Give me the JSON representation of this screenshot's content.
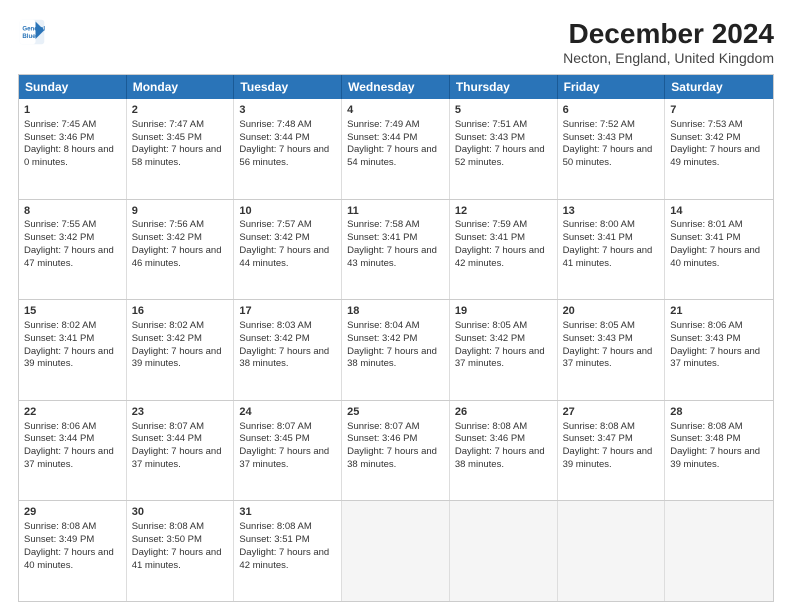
{
  "logo": {
    "line1": "General",
    "line2": "Blue"
  },
  "title": "December 2024",
  "subtitle": "Necton, England, United Kingdom",
  "headers": [
    "Sunday",
    "Monday",
    "Tuesday",
    "Wednesday",
    "Thursday",
    "Friday",
    "Saturday"
  ],
  "weeks": [
    [
      {
        "day": "1",
        "sunrise": "Sunrise: 7:45 AM",
        "sunset": "Sunset: 3:46 PM",
        "daylight": "Daylight: 8 hours and 0 minutes."
      },
      {
        "day": "2",
        "sunrise": "Sunrise: 7:47 AM",
        "sunset": "Sunset: 3:45 PM",
        "daylight": "Daylight: 7 hours and 58 minutes."
      },
      {
        "day": "3",
        "sunrise": "Sunrise: 7:48 AM",
        "sunset": "Sunset: 3:44 PM",
        "daylight": "Daylight: 7 hours and 56 minutes."
      },
      {
        "day": "4",
        "sunrise": "Sunrise: 7:49 AM",
        "sunset": "Sunset: 3:44 PM",
        "daylight": "Daylight: 7 hours and 54 minutes."
      },
      {
        "day": "5",
        "sunrise": "Sunrise: 7:51 AM",
        "sunset": "Sunset: 3:43 PM",
        "daylight": "Daylight: 7 hours and 52 minutes."
      },
      {
        "day": "6",
        "sunrise": "Sunrise: 7:52 AM",
        "sunset": "Sunset: 3:43 PM",
        "daylight": "Daylight: 7 hours and 50 minutes."
      },
      {
        "day": "7",
        "sunrise": "Sunrise: 7:53 AM",
        "sunset": "Sunset: 3:42 PM",
        "daylight": "Daylight: 7 hours and 49 minutes."
      }
    ],
    [
      {
        "day": "8",
        "sunrise": "Sunrise: 7:55 AM",
        "sunset": "Sunset: 3:42 PM",
        "daylight": "Daylight: 7 hours and 47 minutes."
      },
      {
        "day": "9",
        "sunrise": "Sunrise: 7:56 AM",
        "sunset": "Sunset: 3:42 PM",
        "daylight": "Daylight: 7 hours and 46 minutes."
      },
      {
        "day": "10",
        "sunrise": "Sunrise: 7:57 AM",
        "sunset": "Sunset: 3:42 PM",
        "daylight": "Daylight: 7 hours and 44 minutes."
      },
      {
        "day": "11",
        "sunrise": "Sunrise: 7:58 AM",
        "sunset": "Sunset: 3:41 PM",
        "daylight": "Daylight: 7 hours and 43 minutes."
      },
      {
        "day": "12",
        "sunrise": "Sunrise: 7:59 AM",
        "sunset": "Sunset: 3:41 PM",
        "daylight": "Daylight: 7 hours and 42 minutes."
      },
      {
        "day": "13",
        "sunrise": "Sunrise: 8:00 AM",
        "sunset": "Sunset: 3:41 PM",
        "daylight": "Daylight: 7 hours and 41 minutes."
      },
      {
        "day": "14",
        "sunrise": "Sunrise: 8:01 AM",
        "sunset": "Sunset: 3:41 PM",
        "daylight": "Daylight: 7 hours and 40 minutes."
      }
    ],
    [
      {
        "day": "15",
        "sunrise": "Sunrise: 8:02 AM",
        "sunset": "Sunset: 3:41 PM",
        "daylight": "Daylight: 7 hours and 39 minutes."
      },
      {
        "day": "16",
        "sunrise": "Sunrise: 8:02 AM",
        "sunset": "Sunset: 3:42 PM",
        "daylight": "Daylight: 7 hours and 39 minutes."
      },
      {
        "day": "17",
        "sunrise": "Sunrise: 8:03 AM",
        "sunset": "Sunset: 3:42 PM",
        "daylight": "Daylight: 7 hours and 38 minutes."
      },
      {
        "day": "18",
        "sunrise": "Sunrise: 8:04 AM",
        "sunset": "Sunset: 3:42 PM",
        "daylight": "Daylight: 7 hours and 38 minutes."
      },
      {
        "day": "19",
        "sunrise": "Sunrise: 8:05 AM",
        "sunset": "Sunset: 3:42 PM",
        "daylight": "Daylight: 7 hours and 37 minutes."
      },
      {
        "day": "20",
        "sunrise": "Sunrise: 8:05 AM",
        "sunset": "Sunset: 3:43 PM",
        "daylight": "Daylight: 7 hours and 37 minutes."
      },
      {
        "day": "21",
        "sunrise": "Sunrise: 8:06 AM",
        "sunset": "Sunset: 3:43 PM",
        "daylight": "Daylight: 7 hours and 37 minutes."
      }
    ],
    [
      {
        "day": "22",
        "sunrise": "Sunrise: 8:06 AM",
        "sunset": "Sunset: 3:44 PM",
        "daylight": "Daylight: 7 hours and 37 minutes."
      },
      {
        "day": "23",
        "sunrise": "Sunrise: 8:07 AM",
        "sunset": "Sunset: 3:44 PM",
        "daylight": "Daylight: 7 hours and 37 minutes."
      },
      {
        "day": "24",
        "sunrise": "Sunrise: 8:07 AM",
        "sunset": "Sunset: 3:45 PM",
        "daylight": "Daylight: 7 hours and 37 minutes."
      },
      {
        "day": "25",
        "sunrise": "Sunrise: 8:07 AM",
        "sunset": "Sunset: 3:46 PM",
        "daylight": "Daylight: 7 hours and 38 minutes."
      },
      {
        "day": "26",
        "sunrise": "Sunrise: 8:08 AM",
        "sunset": "Sunset: 3:46 PM",
        "daylight": "Daylight: 7 hours and 38 minutes."
      },
      {
        "day": "27",
        "sunrise": "Sunrise: 8:08 AM",
        "sunset": "Sunset: 3:47 PM",
        "daylight": "Daylight: 7 hours and 39 minutes."
      },
      {
        "day": "28",
        "sunrise": "Sunrise: 8:08 AM",
        "sunset": "Sunset: 3:48 PM",
        "daylight": "Daylight: 7 hours and 39 minutes."
      }
    ],
    [
      {
        "day": "29",
        "sunrise": "Sunrise: 8:08 AM",
        "sunset": "Sunset: 3:49 PM",
        "daylight": "Daylight: 7 hours and 40 minutes."
      },
      {
        "day": "30",
        "sunrise": "Sunrise: 8:08 AM",
        "sunset": "Sunset: 3:50 PM",
        "daylight": "Daylight: 7 hours and 41 minutes."
      },
      {
        "day": "31",
        "sunrise": "Sunrise: 8:08 AM",
        "sunset": "Sunset: 3:51 PM",
        "daylight": "Daylight: 7 hours and 42 minutes."
      },
      null,
      null,
      null,
      null
    ]
  ]
}
